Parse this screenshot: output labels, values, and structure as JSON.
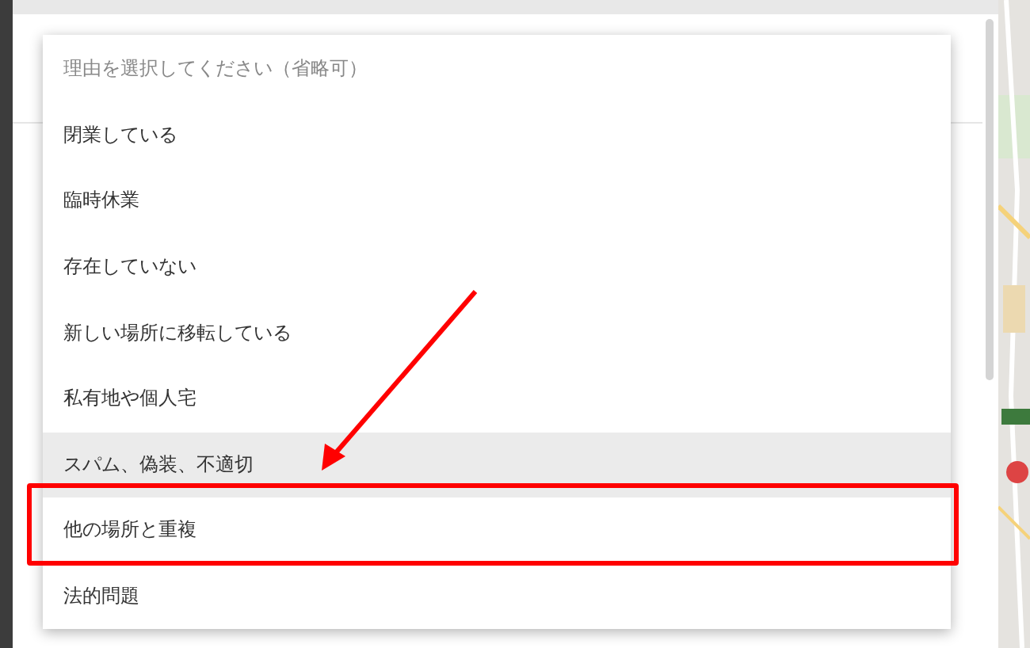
{
  "menu": {
    "placeholder": "理由を選択してください（省略可）",
    "items": [
      {
        "label": "閉業している",
        "highlighted": false
      },
      {
        "label": "臨時休業",
        "highlighted": false
      },
      {
        "label": "存在していない",
        "highlighted": false
      },
      {
        "label": "新しい場所に移転している",
        "highlighted": false
      },
      {
        "label": "私有地や個人宅",
        "highlighted": false
      },
      {
        "label": "スパム、偽装、不適切",
        "highlighted": true
      },
      {
        "label": "他の場所と重複",
        "highlighted": false,
        "framed": true
      },
      {
        "label": "法的問題",
        "highlighted": false
      }
    ]
  },
  "pointer_arrow": true
}
